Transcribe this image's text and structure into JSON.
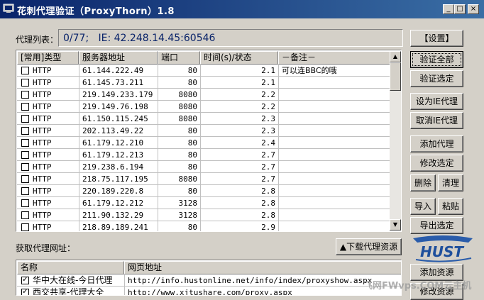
{
  "window": {
    "title": "花刺代理验证（ProxyThorn）1.8",
    "controls": {
      "minimize": "_",
      "maximize": "□",
      "close": "×"
    }
  },
  "proxy_list": {
    "label": "代理列表：",
    "status": "0/77;   IE: 42.248.14.45:60546",
    "columns": [
      "[常用]类型",
      "服务器地址",
      "端口",
      "时间(s)/状态",
      "－备注－"
    ],
    "rows": [
      {
        "checked": false,
        "type": "HTTP",
        "address": "61.144.222.49",
        "port": "80",
        "time": "2.1",
        "note": "可以连BBC的哦"
      },
      {
        "checked": false,
        "type": "HTTP",
        "address": "61.145.73.211",
        "port": "80",
        "time": "2.1",
        "note": ""
      },
      {
        "checked": false,
        "type": "HTTP",
        "address": "219.149.233.179",
        "port": "8080",
        "time": "2.2",
        "note": ""
      },
      {
        "checked": false,
        "type": "HTTP",
        "address": "219.149.76.198",
        "port": "8080",
        "time": "2.2",
        "note": ""
      },
      {
        "checked": false,
        "type": "HTTP",
        "address": "61.150.115.245",
        "port": "8080",
        "time": "2.3",
        "note": ""
      },
      {
        "checked": false,
        "type": "HTTP",
        "address": "202.113.49.22",
        "port": "80",
        "time": "2.3",
        "note": ""
      },
      {
        "checked": false,
        "type": "HTTP",
        "address": "61.179.12.210",
        "port": "80",
        "time": "2.4",
        "note": ""
      },
      {
        "checked": false,
        "type": "HTTP",
        "address": "61.179.12.213",
        "port": "80",
        "time": "2.7",
        "note": ""
      },
      {
        "checked": false,
        "type": "HTTP",
        "address": "219.238.6.194",
        "port": "80",
        "time": "2.7",
        "note": ""
      },
      {
        "checked": false,
        "type": "HTTP",
        "address": "218.75.117.195",
        "port": "8080",
        "time": "2.7",
        "note": ""
      },
      {
        "checked": false,
        "type": "HTTP",
        "address": "220.189.220.8",
        "port": "80",
        "time": "2.8",
        "note": ""
      },
      {
        "checked": false,
        "type": "HTTP",
        "address": "61.179.12.212",
        "port": "3128",
        "time": "2.8",
        "note": ""
      },
      {
        "checked": false,
        "type": "HTTP",
        "address": "211.90.132.29",
        "port": "3128",
        "time": "2.8",
        "note": ""
      },
      {
        "checked": false,
        "type": "HTTP",
        "address": "218.89.189.241",
        "port": "80",
        "time": "2.9",
        "note": ""
      }
    ]
  },
  "buttons": {
    "settings": "【设置】",
    "verify_all": "验证全部",
    "verify_selected": "验证选定",
    "set_ie_proxy": "设为IE代理",
    "cancel_ie_proxy": "取消IE代理",
    "add_proxy": "添加代理",
    "edit_selected": "修改选定",
    "delete": "删除",
    "clean": "清理",
    "import": "导入",
    "paste": "粘贴",
    "export_selected": "导出选定",
    "add_resource": "添加资源",
    "edit_resource": "修改资源",
    "download_resources": "▲下载代理资源"
  },
  "sources": {
    "label": "获取代理网址：",
    "columns": [
      "名称",
      "网页地址"
    ],
    "rows": [
      {
        "checked": true,
        "name": "华中大在线-今日代理",
        "url": "http://info.hustonline.net/info/index/proxyshow.aspx"
      },
      {
        "checked": true,
        "name": "西交共享-代理大全",
        "url": "http://www.xjtushare.com/proxy.aspx"
      }
    ]
  },
  "logo_text": "HUST",
  "watermark": "飞网FWvps.COM云主机"
}
